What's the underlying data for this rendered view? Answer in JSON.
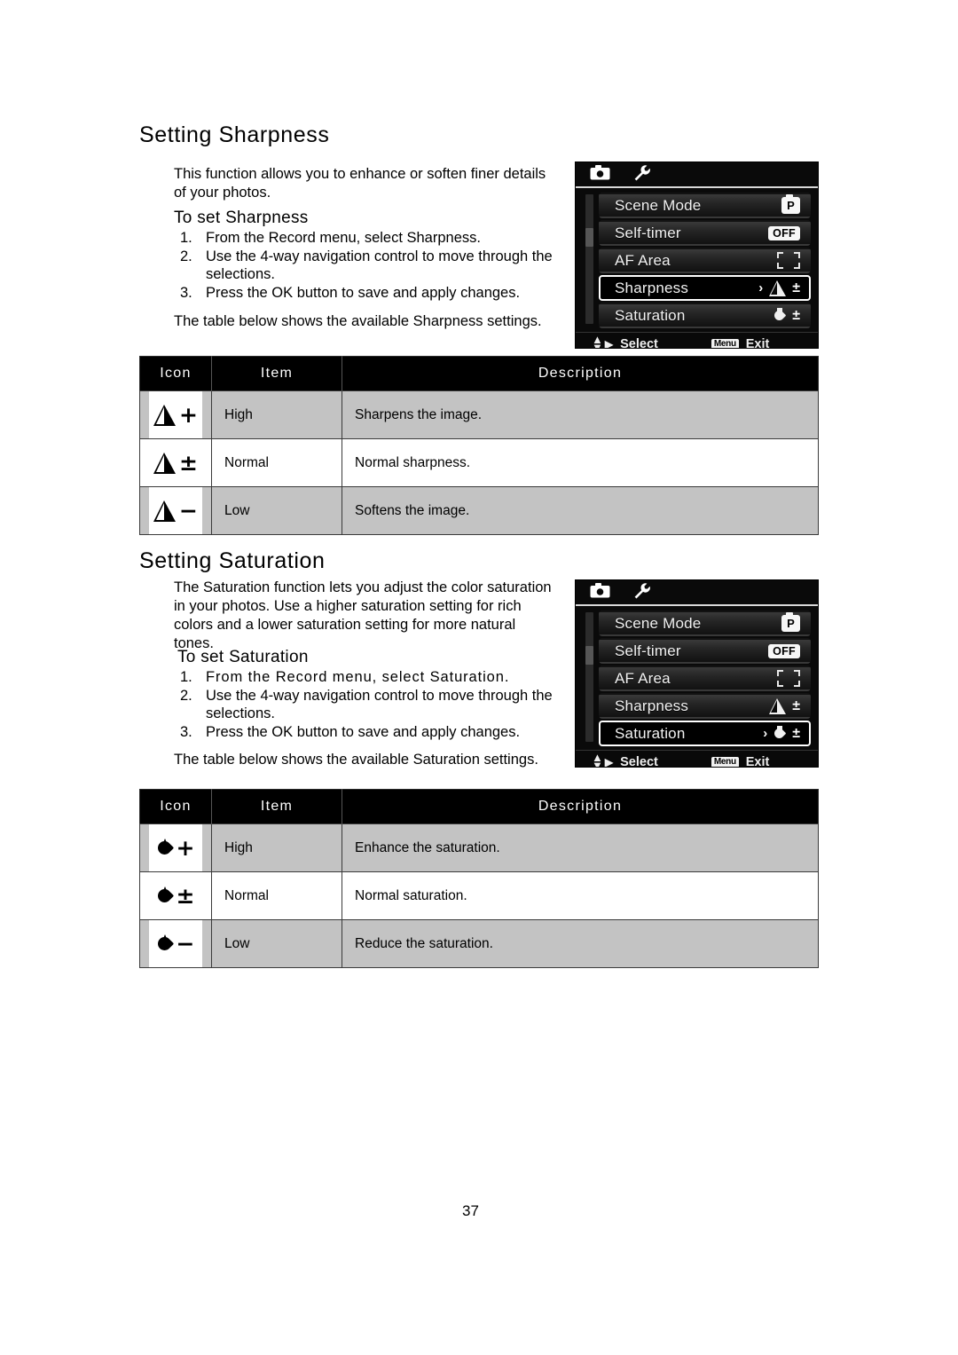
{
  "page": {
    "number": "37"
  },
  "sections": [
    {
      "heading": "Setting Sharpness",
      "intro": "This function allows you to enhance or soften finer details of your photos.",
      "subheading": "To set Sharpness",
      "steps": [
        {
          "num": "1.",
          "text": "From the Record menu, select Sharpness."
        },
        {
          "num": "2.",
          "text": "Use the 4-way navigation control to move through the selections."
        },
        {
          "num": "3.",
          "text": "Press the OK button to save and apply changes."
        }
      ],
      "table_intro": "The table below shows the available Sharpness settings.",
      "table": {
        "headers": [
          "Icon",
          "Item",
          "Description"
        ],
        "rows": [
          {
            "icon": "sharpness-high-icon",
            "symbol": "+",
            "item": "High",
            "description": "Sharpens the image."
          },
          {
            "icon": "sharpness-normal-icon",
            "symbol": "±",
            "item": "Normal",
            "description": "Normal sharpness."
          },
          {
            "icon": "sharpness-low-icon",
            "symbol": "−",
            "item": "Low",
            "description": "Softens the image."
          }
        ]
      }
    },
    {
      "heading": "Setting Saturation",
      "intro": "The Saturation function lets you adjust the color saturation in your photos. Use a higher saturation setting for rich colors and a lower saturation setting for more natural tones.",
      "subheading": "To set Saturation",
      "steps": [
        {
          "num": "1.",
          "text": "From the Record menu, select Saturation."
        },
        {
          "num": "2.",
          "text": "Use the 4-way navigation control to move through the selections."
        },
        {
          "num": "3.",
          "text": "Press the OK button to save and apply changes."
        }
      ],
      "table_intro": "The table below shows the available Saturation settings.",
      "table": {
        "headers": [
          "Icon",
          "Item",
          "Description"
        ],
        "rows": [
          {
            "icon": "saturation-high-icon",
            "symbol": "+",
            "item": "High",
            "description": "Enhance the saturation."
          },
          {
            "icon": "saturation-normal-icon",
            "symbol": "±",
            "item": "Normal",
            "description": "Normal saturation."
          },
          {
            "icon": "saturation-low-icon",
            "symbol": "−",
            "item": "Low",
            "description": "Reduce the saturation."
          }
        ]
      }
    }
  ],
  "lcd_menus": [
    {
      "tabs": [
        "record-camera-tab",
        "setup-wrench-tab"
      ],
      "items": [
        {
          "label": "Scene Mode",
          "value": "P",
          "value_type": "p-badge",
          "selected": false
        },
        {
          "label": "Self-timer",
          "value": "OFF",
          "value_type": "off-badge",
          "selected": false
        },
        {
          "label": "AF Area",
          "value": "",
          "value_type": "af-frame",
          "selected": false
        },
        {
          "label": "Sharpness",
          "value": "±",
          "value_type": "sharpness",
          "selected": true
        },
        {
          "label": "Saturation",
          "value": "±",
          "value_type": "saturation",
          "selected": false
        }
      ],
      "footer": {
        "select_label": "Select",
        "menu_badge": "Menu",
        "exit_label": "Exit"
      }
    },
    {
      "tabs": [
        "record-camera-tab",
        "setup-wrench-tab"
      ],
      "items": [
        {
          "label": "Scene Mode",
          "value": "P",
          "value_type": "p-badge",
          "selected": false
        },
        {
          "label": "Self-timer",
          "value": "OFF",
          "value_type": "off-badge",
          "selected": false
        },
        {
          "label": "AF Area",
          "value": "",
          "value_type": "af-frame",
          "selected": false
        },
        {
          "label": "Sharpness",
          "value": "±",
          "value_type": "sharpness",
          "selected": false
        },
        {
          "label": "Saturation",
          "value": "±",
          "value_type": "saturation",
          "selected": true
        }
      ],
      "footer": {
        "select_label": "Select",
        "menu_badge": "Menu",
        "exit_label": "Exit"
      }
    }
  ],
  "colors": {
    "table_header_bg": "#000000",
    "table_shade_bg": "#c3c3c3",
    "lcd_bg": "#0a0a0a",
    "lcd_text": "#f2f2f2"
  }
}
